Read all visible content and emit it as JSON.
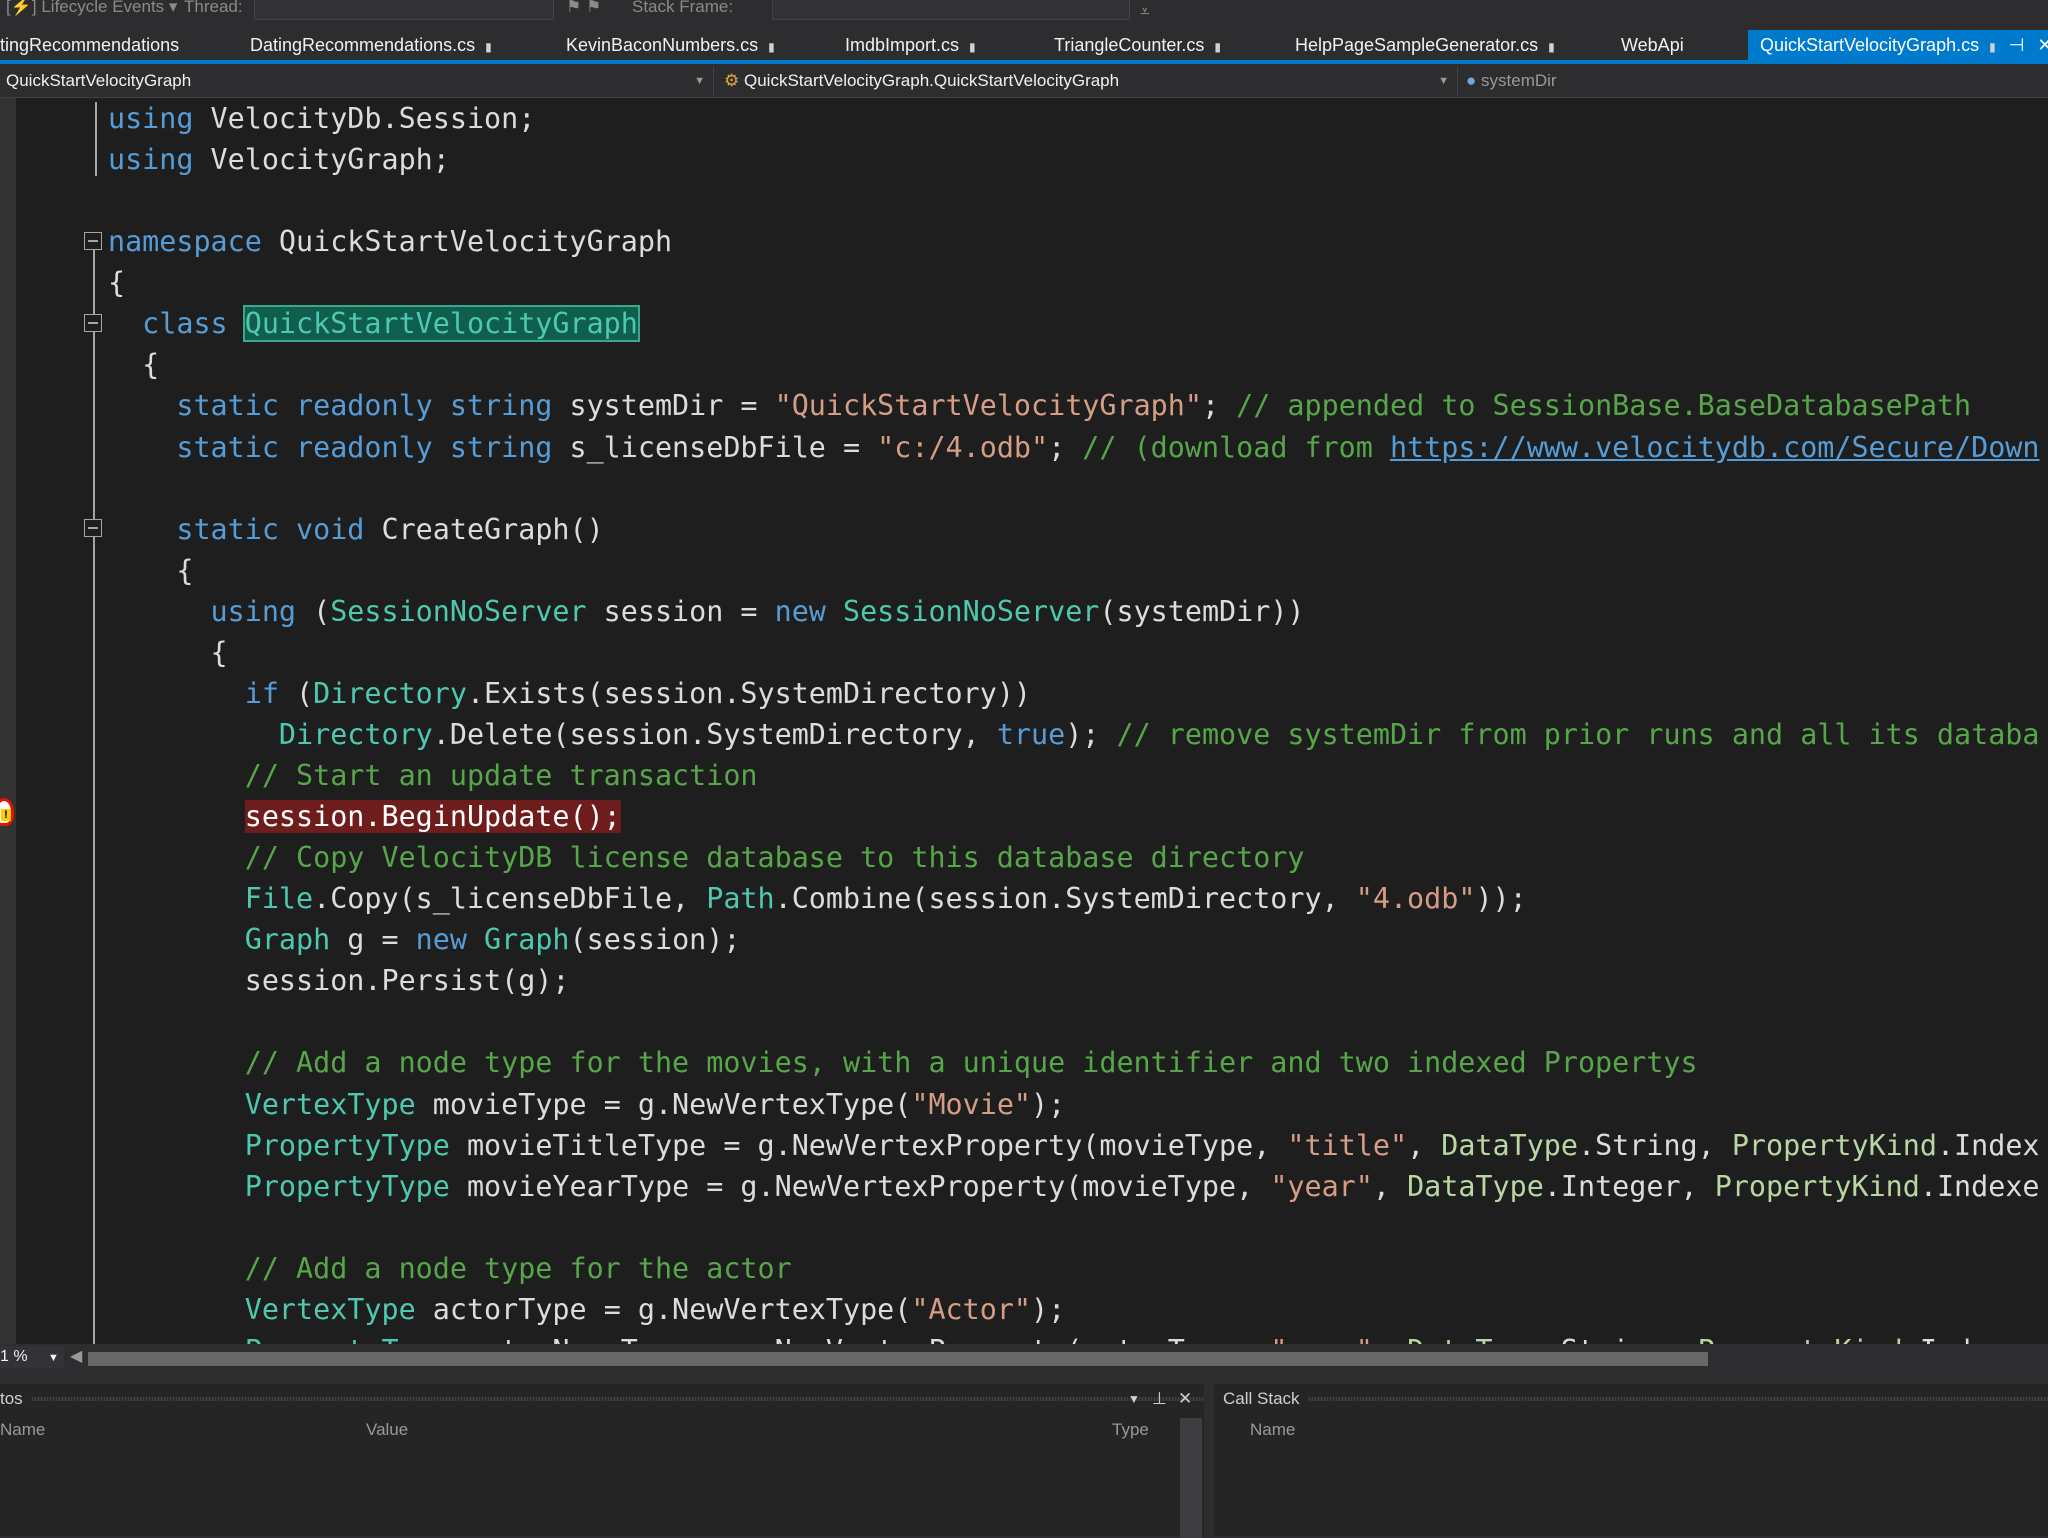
{
  "toolbar": {
    "lifecycle": "Lifecycle Events",
    "thread_label": "Thread:",
    "stack_frame_label": "Stack Frame:"
  },
  "tabs": [
    {
      "label": "tingRecommendations",
      "pinned": false
    },
    {
      "label": "DatingRecommendations.cs",
      "pinned": true
    },
    {
      "label": "KevinBaconNumbers.cs",
      "pinned": true
    },
    {
      "label": "ImdbImport.cs",
      "pinned": true
    },
    {
      "label": "TriangleCounter.cs",
      "pinned": true
    },
    {
      "label": "HelpPageSampleGenerator.cs",
      "pinned": true
    },
    {
      "label": "WebApi",
      "pinned": false
    },
    {
      "label": "QuickStartVelocityGraph.cs",
      "pinned": true,
      "active": true
    }
  ],
  "navbar": {
    "project": "QuickStartVelocityGraph",
    "type": "QuickStartVelocityGraph.QuickStartVelocityGraph",
    "member": "systemDir"
  },
  "colors": {
    "accent": "#007acc",
    "keyword": "#569cd6",
    "type": "#4ec9b0",
    "string": "#d69d85",
    "comment": "#57a64a",
    "breakpoint_line": "#6e1c1c"
  },
  "code": [
    {
      "i": 0,
      "t": [
        [
          "k",
          "using"
        ],
        [
          "p",
          " VelocityDb.Session;"
        ]
      ]
    },
    {
      "i": 0,
      "t": [
        [
          "k",
          "using"
        ],
        [
          "p",
          " VelocityGraph;"
        ]
      ]
    },
    {
      "i": 0,
      "t": []
    },
    {
      "i": 0,
      "t": [
        [
          "k",
          "namespace"
        ],
        [
          "p",
          " QuickStartVelocityGraph"
        ]
      ]
    },
    {
      "i": 0,
      "t": [
        [
          "p",
          "{"
        ]
      ]
    },
    {
      "i": 2,
      "t": [
        [
          "k",
          "class"
        ],
        [
          "p",
          " "
        ],
        [
          "h1",
          "QuickStartVelocityGraph"
        ]
      ]
    },
    {
      "i": 2,
      "t": [
        [
          "p",
          "{"
        ]
      ]
    },
    {
      "i": 4,
      "t": [
        [
          "k",
          "static readonly string"
        ],
        [
          "p",
          " systemDir = "
        ],
        [
          "s",
          "\"QuickStartVelocityGraph\""
        ],
        [
          "p",
          "; "
        ],
        [
          "c",
          "// appended to SessionBase.BaseDatabasePath"
        ]
      ]
    },
    {
      "i": 4,
      "t": [
        [
          "k",
          "static readonly string"
        ],
        [
          "p",
          " s_licenseDbFile = "
        ],
        [
          "s",
          "\"c:/4.odb\""
        ],
        [
          "p",
          "; "
        ],
        [
          "c",
          "// (download from "
        ],
        [
          "u",
          "https://www.velocitydb.com/Secure/Down"
        ]
      ]
    },
    {
      "i": 0,
      "t": []
    },
    {
      "i": 4,
      "t": [
        [
          "k",
          "static void"
        ],
        [
          "p",
          " CreateGraph()"
        ]
      ]
    },
    {
      "i": 4,
      "t": [
        [
          "p",
          "{"
        ]
      ]
    },
    {
      "i": 6,
      "t": [
        [
          "k",
          "using"
        ],
        [
          "p",
          " ("
        ],
        [
          "t",
          "SessionNoServer"
        ],
        [
          "p",
          " session = "
        ],
        [
          "k",
          "new"
        ],
        [
          "p",
          " "
        ],
        [
          "t",
          "SessionNoServer"
        ],
        [
          "p",
          "(systemDir))"
        ]
      ]
    },
    {
      "i": 6,
      "t": [
        [
          "p",
          "{"
        ]
      ]
    },
    {
      "i": 8,
      "t": [
        [
          "k",
          "if"
        ],
        [
          "p",
          " ("
        ],
        [
          "t",
          "Directory"
        ],
        [
          "p",
          ".Exists(session.SystemDirectory))"
        ]
      ]
    },
    {
      "i": 10,
      "t": [
        [
          "t",
          "Directory"
        ],
        [
          "p",
          ".Delete(session.SystemDirectory, "
        ],
        [
          "k",
          "true"
        ],
        [
          "p",
          "); "
        ],
        [
          "c",
          "// remove systemDir from prior runs and all its databa"
        ]
      ]
    },
    {
      "i": 8,
      "t": [
        [
          "c",
          "// Start an update transaction"
        ]
      ]
    },
    {
      "i": 8,
      "t": [
        [
          "h2",
          "session.BeginUpdate();"
        ]
      ]
    },
    {
      "i": 8,
      "t": [
        [
          "c",
          "// Copy VelocityDB license database to this database directory"
        ]
      ]
    },
    {
      "i": 8,
      "t": [
        [
          "t",
          "File"
        ],
        [
          "p",
          ".Copy(s_licenseDbFile, "
        ],
        [
          "t",
          "Path"
        ],
        [
          "p",
          ".Combine(session.SystemDirectory, "
        ],
        [
          "s",
          "\"4.odb\""
        ],
        [
          "p",
          "));"
        ]
      ]
    },
    {
      "i": 8,
      "t": [
        [
          "t",
          "Graph"
        ],
        [
          "p",
          " g = "
        ],
        [
          "k",
          "new"
        ],
        [
          "p",
          " "
        ],
        [
          "t",
          "Graph"
        ],
        [
          "p",
          "(session);"
        ]
      ]
    },
    {
      "i": 8,
      "t": [
        [
          "p",
          "session.Persist(g);"
        ]
      ]
    },
    {
      "i": 0,
      "t": []
    },
    {
      "i": 8,
      "t": [
        [
          "c",
          "// Add a node type for the movies, with a unique identifier and two indexed Propertys"
        ]
      ]
    },
    {
      "i": 8,
      "t": [
        [
          "t",
          "VertexType"
        ],
        [
          "p",
          " movieType = g.NewVertexType("
        ],
        [
          "s",
          "\"Movie\""
        ],
        [
          "p",
          ");"
        ]
      ]
    },
    {
      "i": 8,
      "t": [
        [
          "t",
          "PropertyType"
        ],
        [
          "p",
          " movieTitleType = g.NewVertexProperty(movieType, "
        ],
        [
          "s",
          "\"title\""
        ],
        [
          "p",
          ", "
        ],
        [
          "e",
          "DataType"
        ],
        [
          "p",
          ".String, "
        ],
        [
          "e",
          "PropertyKind"
        ],
        [
          "p",
          ".Index"
        ]
      ]
    },
    {
      "i": 8,
      "t": [
        [
          "t",
          "PropertyType"
        ],
        [
          "p",
          " movieYearType = g.NewVertexProperty(movieType, "
        ],
        [
          "s",
          "\"year\""
        ],
        [
          "p",
          ", "
        ],
        [
          "e",
          "DataType"
        ],
        [
          "p",
          ".Integer, "
        ],
        [
          "e",
          "PropertyKind"
        ],
        [
          "p",
          ".Indexe"
        ]
      ]
    },
    {
      "i": 0,
      "t": []
    },
    {
      "i": 8,
      "t": [
        [
          "c",
          "// Add a node type for the actor"
        ]
      ]
    },
    {
      "i": 8,
      "t": [
        [
          "t",
          "VertexType"
        ],
        [
          "p",
          " actorType = g.NewVertexType("
        ],
        [
          "s",
          "\"Actor\""
        ],
        [
          "p",
          ");"
        ]
      ]
    },
    {
      "i": 8,
      "t": [
        [
          "t",
          "PropertyType"
        ],
        [
          "p",
          " actorNameType = g.NewVertexProperty(actorType, "
        ],
        [
          "s",
          "\"name\""
        ],
        [
          "p",
          ", "
        ],
        [
          "e",
          "DataType"
        ],
        [
          "p",
          ".String, "
        ],
        [
          "e",
          "PropertyKind"
        ],
        [
          "p",
          ".Indexe"
        ]
      ]
    }
  ],
  "editor": {
    "zoom": "1 %"
  },
  "autos": {
    "title": "tos",
    "columns": [
      "Name",
      "Value",
      "Type"
    ]
  },
  "callstack": {
    "title": "Call Stack",
    "columns": [
      "Name"
    ]
  }
}
